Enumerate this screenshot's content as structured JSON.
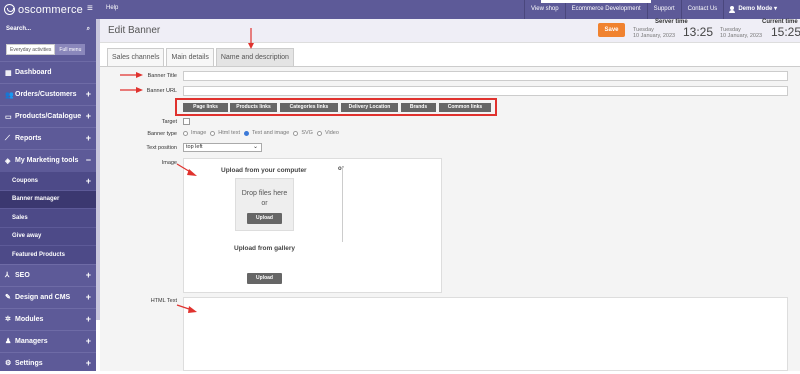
{
  "app": {
    "logo_text": "oscommerce",
    "help": "Help"
  },
  "topnav": {
    "links": [
      "View shop",
      "Ecommerce Development",
      "Support",
      "Contact Us"
    ],
    "user": "Demo Mode ▾"
  },
  "sidebar": {
    "search_label": "Search...",
    "toggle_everyday": "Everyday activities",
    "toggle_full": "Full menu",
    "items": [
      {
        "label": "Dashboard",
        "icon": "dashboard-icon",
        "glyph": "▦"
      },
      {
        "label": "Orders/Customers",
        "icon": "users-icon",
        "glyph": "👥"
      },
      {
        "label": "Products/Catalogue",
        "icon": "folder-icon",
        "glyph": "▭"
      },
      {
        "label": "Reports",
        "icon": "chart-icon",
        "glyph": "⟋"
      },
      {
        "label": "My Marketing tools",
        "icon": "tag-icon",
        "glyph": "◈"
      }
    ],
    "subitems": [
      "Coupons",
      "Banner manager",
      "Sales",
      "Give away",
      "Featured Products"
    ],
    "items_after": [
      {
        "label": "SEO",
        "icon": "seo-icon",
        "glyph": "⅄"
      },
      {
        "label": "Design and CMS",
        "icon": "brush-icon",
        "glyph": "✎"
      },
      {
        "label": "Modules",
        "icon": "modules-icon",
        "glyph": "✲"
      },
      {
        "label": "Managers",
        "icon": "manager-icon",
        "glyph": "♟"
      },
      {
        "label": "Settings",
        "icon": "gear-icon",
        "glyph": "⚙"
      }
    ]
  },
  "header": {
    "title": "Edit Banner",
    "save": "Save",
    "server_time": {
      "label": "Server time",
      "day": "Tuesday",
      "date": "10 January, 2023",
      "time": "13:25"
    },
    "current_time": {
      "label": "Current time",
      "day": "Tuesday",
      "date": "10 January, 2023",
      "time": "15:25"
    }
  },
  "tabs": [
    "Sales channels",
    "Main details",
    "Name and description"
  ],
  "form": {
    "banner_title_label": "Banner Title",
    "banner_url_label": "Banner URL",
    "link_buttons": [
      "Page links",
      "Products links",
      "Categories links",
      "Delivery Location",
      "Brands",
      "Common links"
    ],
    "target_label": "Target",
    "banner_type_label": "Banner type",
    "banner_types": [
      "Image",
      "Html text",
      "Text and image",
      "SVG",
      "Video"
    ],
    "banner_type_selected": "Text and image",
    "text_position_label": "Text position",
    "text_position_value": "top left",
    "image_label": "Image",
    "upload_computer": "Upload from your computer",
    "or": "or",
    "drop_files": "Drop files here",
    "drop_or": "or",
    "upload_btn": "Upload",
    "upload_gallery": "Upload from gallery",
    "html_text_label": "HTML Text"
  },
  "colors": {
    "brand": "#5d5a98",
    "accent": "#f0822f",
    "annotation": "#e0322e"
  }
}
